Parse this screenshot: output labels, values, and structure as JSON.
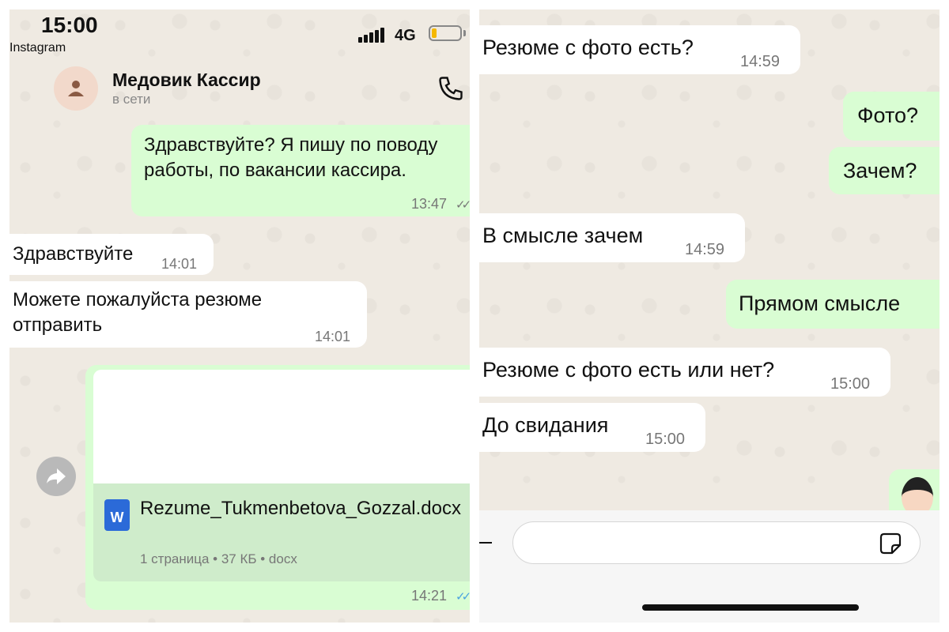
{
  "status_bar": {
    "time": "15:00",
    "source": "Instagram",
    "network": "4G"
  },
  "header": {
    "name": "Медовик Кассир",
    "status": "в сети"
  },
  "left_messages": [
    {
      "text": "Здравствуйте? Я пишу по поводу работы, по вакансии кассира.",
      "time": "13:47",
      "ticks": "✓✓"
    },
    {
      "text": "Здравствуйте",
      "time": "14:01"
    },
    {
      "text": "Можете пожалуйста резюме отправить",
      "time": "14:01"
    }
  ],
  "document": {
    "filename": "Rezume_Tukmenbetova_Gozzal.docx",
    "meta": "1 страница • 37 КБ • docx",
    "icon_letter": "W",
    "time": "14:21",
    "ticks": "✓✓"
  },
  "right_messages": [
    {
      "text": "Резюме с фото есть?",
      "time": "14:59"
    },
    {
      "text": "Фото?"
    },
    {
      "text": "Зачем?"
    },
    {
      "text": "В смысле зачем",
      "time": "14:59"
    },
    {
      "text": "Прямом смысле"
    },
    {
      "text": "Резюме с фото есть или нет?",
      "time": "15:00"
    },
    {
      "text": "До свидания",
      "time": "15:00"
    }
  ],
  "composer": {
    "value": "",
    "placeholder": ""
  },
  "colors": {
    "outgoing": "#d9fdd3",
    "incoming": "#ffffff",
    "background": "#efeae2",
    "read_ticks": "#4aa3e0",
    "word_blue": "#2b6ad8"
  }
}
